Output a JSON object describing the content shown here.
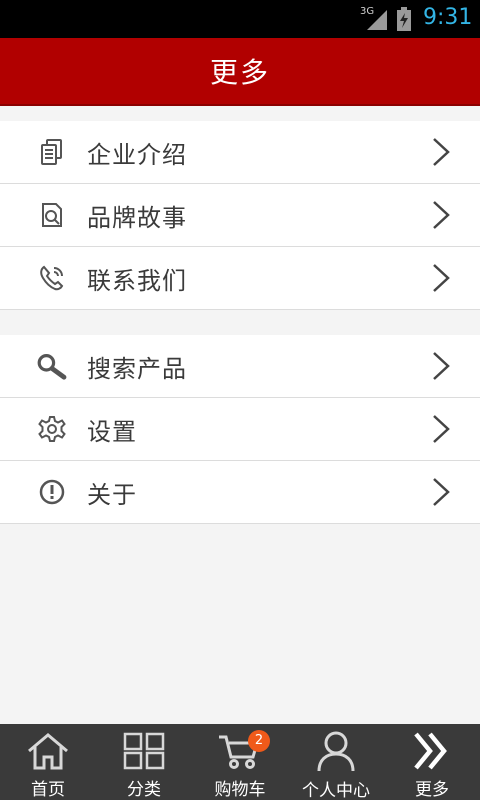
{
  "status_bar": {
    "network": "3G",
    "time": "9:31"
  },
  "header": {
    "title": "更多"
  },
  "menu_group_1": [
    {
      "label": "企业介绍",
      "icon": "document-icon"
    },
    {
      "label": "品牌故事",
      "icon": "document-search-icon"
    },
    {
      "label": "联系我们",
      "icon": "phone-icon"
    }
  ],
  "menu_group_2": [
    {
      "label": "搜索产品",
      "icon": "search-icon"
    },
    {
      "label": "设置",
      "icon": "gear-icon"
    },
    {
      "label": "关于",
      "icon": "info-icon"
    }
  ],
  "tab_bar": {
    "items": [
      {
        "label": "首页",
        "icon": "home-icon"
      },
      {
        "label": "分类",
        "icon": "grid-icon"
      },
      {
        "label": "购物车",
        "icon": "cart-icon"
      },
      {
        "label": "个人中心",
        "icon": "user-icon"
      },
      {
        "label": "更多",
        "icon": "double-chevron-icon"
      }
    ],
    "cart_badge": "2"
  },
  "colors": {
    "header": "#b10000",
    "tab_bar": "#3a3a3a",
    "badge": "#f05a1a",
    "time": "#33b5e5"
  }
}
